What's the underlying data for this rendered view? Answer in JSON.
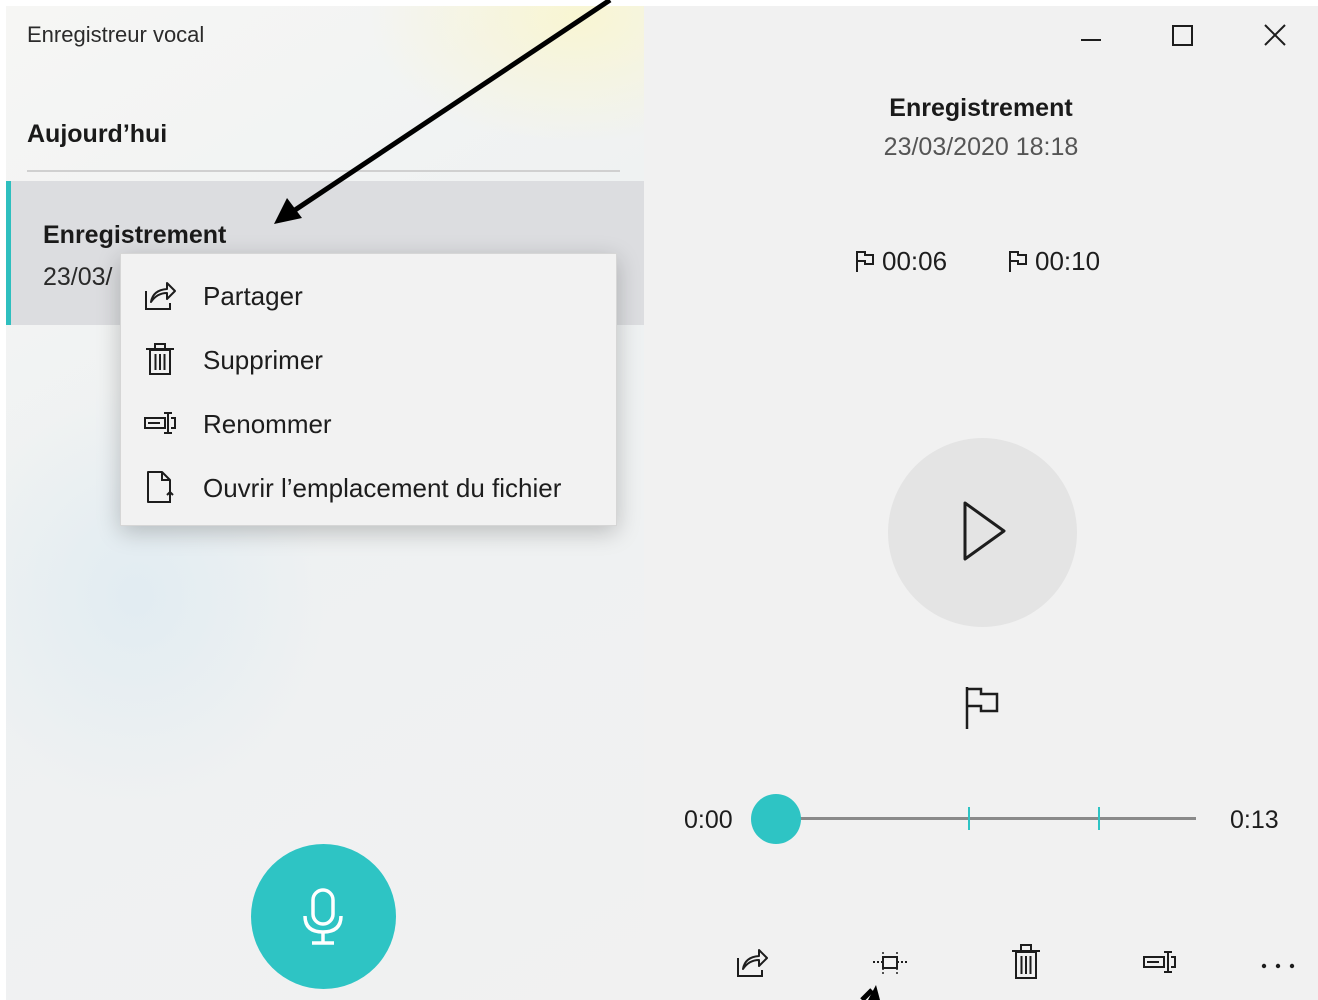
{
  "app": {
    "title": "Enregistreur vocal"
  },
  "list": {
    "section_header": "Aujourd’hui",
    "items": [
      {
        "name": "Enregistrement",
        "date_visible": "23/03/"
      }
    ]
  },
  "record_button": {
    "icon": "microphone-icon"
  },
  "context_menu": {
    "items": [
      {
        "label": "Partager",
        "icon": "share-icon"
      },
      {
        "label": "Supprimer",
        "icon": "trash-icon"
      },
      {
        "label": "Renommer",
        "icon": "rename-icon"
      },
      {
        "label": "Ouvrir l’emplacement du fichier",
        "icon": "file-location-icon"
      }
    ]
  },
  "window_controls": [
    "minimize-icon",
    "maximize-icon",
    "close-icon"
  ],
  "player": {
    "title": "Enregistrement",
    "datetime": "23/03/2020 18:18",
    "markers": [
      "00:06",
      "00:10"
    ],
    "current_time": "0:00",
    "total_time": "0:13",
    "progress_fraction": 0.0,
    "marker_fractions": [
      0.46,
      0.77
    ]
  },
  "bottom_toolbar": [
    "share-icon",
    "trim-icon",
    "trash-icon",
    "rename-icon",
    "more-icon"
  ],
  "colors": {
    "accent": "#2ec4c4",
    "selected_item_bg": "#dcdde0",
    "pane_bg": "#f1f1f1"
  }
}
